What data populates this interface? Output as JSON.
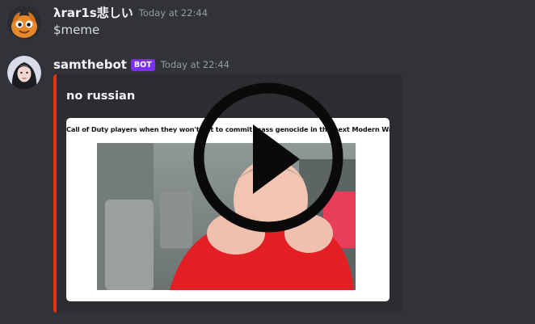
{
  "messages": [
    {
      "username": "λrar1s悲しい",
      "timestamp": "Today at 22:44",
      "content": "$meme",
      "avatar_icon": "cartoon-avatar-icon"
    },
    {
      "username": "samthebot",
      "bot_tag": "BOT",
      "timestamp": "Today at 22:44",
      "avatar_icon": "profile-avatar-icon",
      "embed": {
        "title": "no russian",
        "accent_color": "#e8320f",
        "gif_caption": "Call of Duty players when they won't get to commit mass genocide in the next Modern Warfare game",
        "media_icon": "play-button-icon"
      }
    }
  ],
  "colors": {
    "background": "#313338",
    "embed_background": "#2b2d31",
    "bot_tag": "#7b2ff2",
    "timestamp": "#949ba4"
  }
}
